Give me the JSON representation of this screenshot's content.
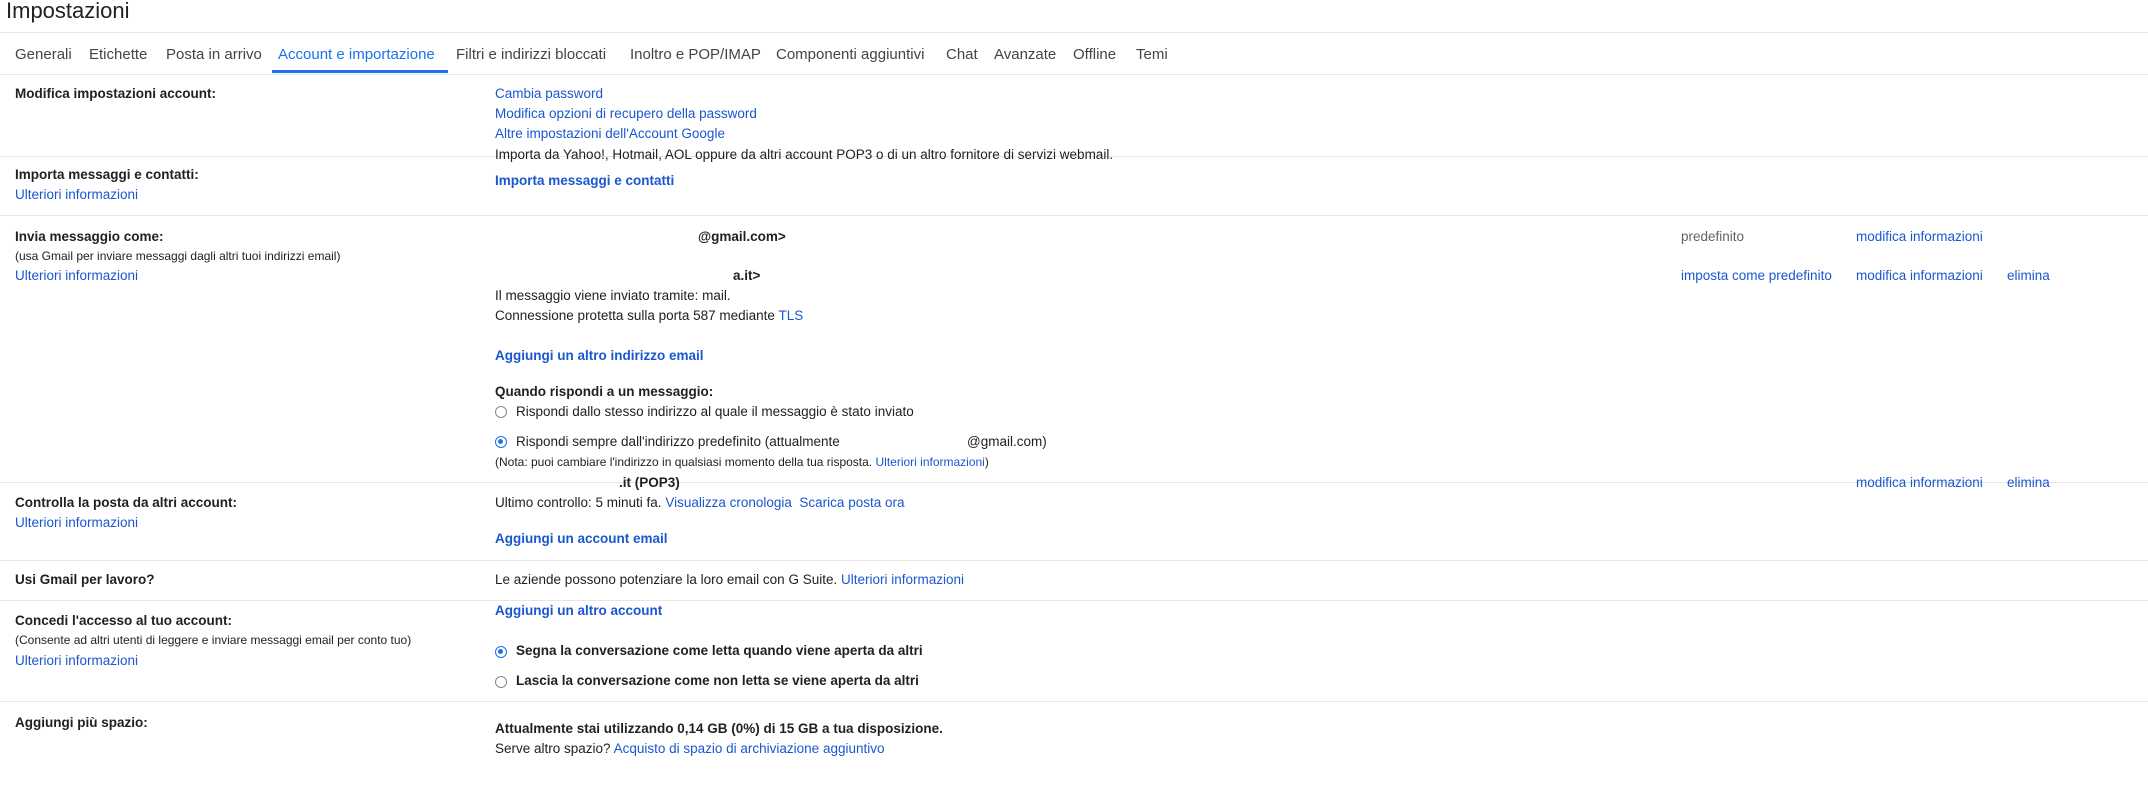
{
  "page": {
    "title": "Impostazioni"
  },
  "tabs": [
    {
      "label": "Generali"
    },
    {
      "label": "Etichette"
    },
    {
      "label": "Posta in arrivo"
    },
    {
      "label": "Account e importazione"
    },
    {
      "label": "Filtri e indirizzi bloccati"
    },
    {
      "label": "Inoltro e POP/IMAP"
    },
    {
      "label": "Componenti aggiuntivi"
    },
    {
      "label": "Chat"
    },
    {
      "label": "Avanzate"
    },
    {
      "label": "Offline"
    },
    {
      "label": "Temi"
    }
  ],
  "account": {
    "label": "Modifica impostazioni account:",
    "links": [
      "Cambia password",
      "Modifica opzioni di recupero della password",
      "Altre impostazioni dell'Account Google"
    ]
  },
  "import": {
    "label": "Importa messaggi e contatti:",
    "more": "Ulteriori informazioni",
    "desc": "Importa da Yahoo!, Hotmail, AOL oppure da altri account POP3 o di un altro fornitore di servizi webmail.",
    "action": "Importa messaggi e contatti"
  },
  "send_as": {
    "label": "Invia messaggio come:",
    "sub": "(usa Gmail per inviare messaggi dagli altri tuoi indirizzi email)",
    "more": "Ulteriori informazioni",
    "addr1": "@gmail.com>",
    "default": "predefinito",
    "edit": "modifica informazioni",
    "addr2": "a.it>",
    "set_default": "imposta come predefinito",
    "delete": "elimina",
    "via": "Il messaggio viene inviato tramite: mail.",
    "secure": "Connessione protetta sulla porta 587 mediante",
    "tls": "TLS",
    "add": "Aggiungi un altro indirizzo email",
    "reply_label": "Quando rispondi a un messaggio:",
    "reply_opt1": "Rispondi dallo stesso indirizzo al quale il messaggio è stato inviato",
    "reply_opt2_a": "Rispondi sempre dall'indirizzo predefinito (attualmente",
    "reply_opt2_b": "@gmail.com)",
    "note": "(Nota: puoi cambiare l'indirizzo in qualsiasi momento della tua risposta.",
    "note_link": "Ulteriori informazioni",
    "note_end": ")"
  },
  "check_mail": {
    "label": "Controlla la posta da altri account:",
    "more": "Ulteriori informazioni",
    "account": ".it (POP3)",
    "edit": "modifica informazioni",
    "delete": "elimina",
    "last": "Ultimo controllo: 5 minuti fa.",
    "history": "Visualizza cronologia",
    "fetch": "Scarica posta ora",
    "add": "Aggiungi un account email"
  },
  "work": {
    "label": "Usi Gmail per lavoro?",
    "desc": "Le aziende possono potenziare la loro email con G Suite.",
    "more": "Ulteriori informazioni"
  },
  "grant": {
    "label": "Concedi l'accesso al tuo account:",
    "sub": "(Consente ad altri utenti di leggere e inviare messaggi email per conto tuo)",
    "more": "Ulteriori informazioni",
    "add": "Aggiungi un altro account",
    "opt1": "Segna la conversazione come letta quando viene aperta da altri",
    "opt2": "Lascia la conversazione come non letta se viene aperta da altri"
  },
  "storage": {
    "label": "Aggiungi più spazio:",
    "usage": "Attualmente stai utilizzando 0,14 GB (0%) di 15 GB a tua disposizione.",
    "q": "Serve altro spazio?",
    "buy": "Acquisto di spazio di archiviazione aggiuntivo"
  }
}
